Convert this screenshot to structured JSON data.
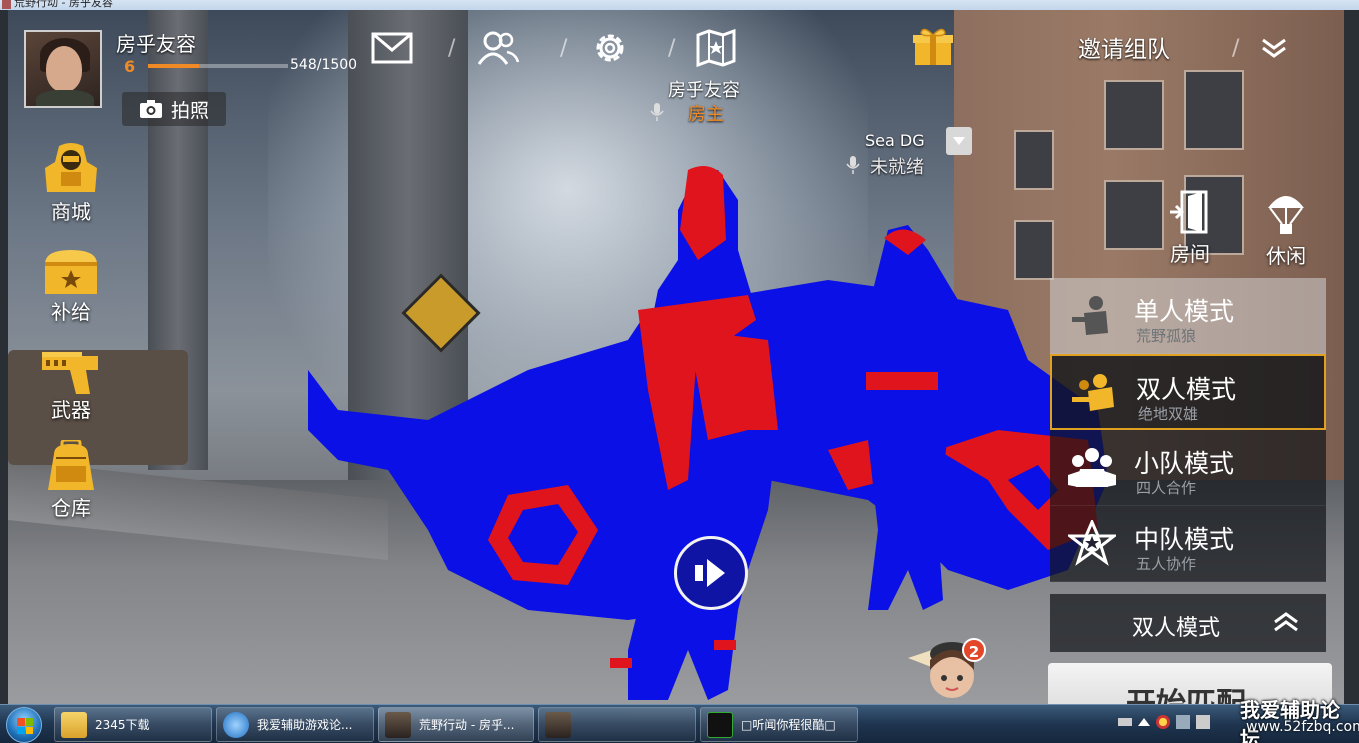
{
  "window": {
    "title": "荒野行动 - 房乎友容"
  },
  "player": {
    "name": "房乎友容",
    "level": "6",
    "xp_text": "548/1500",
    "xp_progress": 0.365
  },
  "photo_button": {
    "label": "拍照"
  },
  "top_nav": {
    "icons": [
      "mail-icon",
      "friends-icon",
      "settings-icon",
      "map-icon",
      "gift-icon"
    ],
    "invite_label": "邀请组队"
  },
  "host": {
    "name": "房乎友容",
    "role": "房主"
  },
  "teammate": {
    "name": "Sea    DG",
    "status": "未就绪"
  },
  "left_nav": [
    {
      "label": "商城",
      "icon": "shop-hoodie-icon"
    },
    {
      "label": "补给",
      "icon": "supply-chest-icon"
    },
    {
      "label": "武器",
      "icon": "weapon-gun-icon"
    },
    {
      "label": "仓库",
      "icon": "backpack-icon"
    }
  ],
  "right_nav": [
    {
      "label": "房间",
      "icon": "door-exit-icon"
    },
    {
      "label": "休闲",
      "icon": "parachute-icon"
    }
  ],
  "modes": [
    {
      "title": "单人模式",
      "subtitle": "荒野孤狼",
      "icon": "solo-soldier-icon"
    },
    {
      "title": "双人模式",
      "subtitle": "绝地双雄",
      "icon": "duo-soldiers-icon",
      "selected": true
    },
    {
      "title": "小队模式",
      "subtitle": "四人合作",
      "icon": "squad-icon"
    },
    {
      "title": "中队模式",
      "subtitle": "五人协作",
      "icon": "star-badge-icon"
    }
  ],
  "mode_select": {
    "label": "双人模式"
  },
  "start_button": {
    "label": "开始匹配"
  },
  "npc_assistant": {
    "badge": "2"
  },
  "taskbar": {
    "items": [
      {
        "label": "2345下载",
        "icon": "folder-icon"
      },
      {
        "label": "我爱辅助游戏论...",
        "icon": "ie-icon"
      },
      {
        "label": "荒野行动 - 房乎...",
        "icon": "game-icon",
        "active": true
      },
      {
        "label": "",
        "icon": "game-icon-2"
      },
      {
        "label": "□听闻你程很酷□",
        "icon": "app-icon"
      }
    ]
  },
  "watermark": {
    "line1": "我爱辅助论坛",
    "line2": "www.52fzbq.com"
  },
  "colors": {
    "accent_orange": "#f08a24",
    "selection_gold": "#e0a020",
    "silhouette_blue": "#0a10e6",
    "silhouette_red": "#e0141c"
  }
}
